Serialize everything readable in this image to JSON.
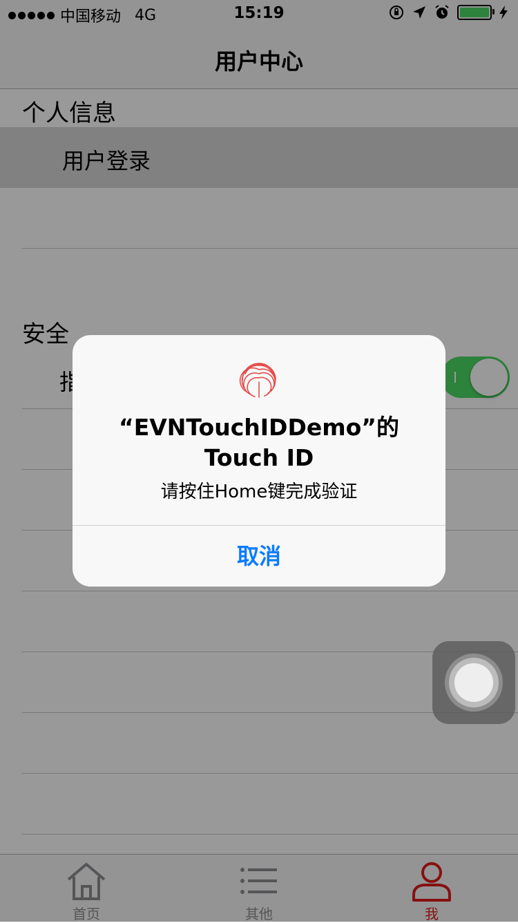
{
  "status_bar": {
    "carrier": "中国移动",
    "network": "4G",
    "time": "15:19",
    "icons": [
      "orientation-lock-icon",
      "location-arrow-icon",
      "alarm-icon",
      "battery-icon",
      "charging-bolt-icon"
    ]
  },
  "nav": {
    "title": "用户中心"
  },
  "sections": {
    "personal": {
      "header": "个人信息",
      "rows": [
        {
          "label": "用户登录"
        }
      ]
    },
    "security": {
      "header": "安全",
      "rows": [
        {
          "label": "指"
        }
      ],
      "toggle_on": true
    }
  },
  "alert": {
    "icon": "fingerprint-icon",
    "title": "“EVNTouchIDDemo”的 Touch ID",
    "message": "请按住Home键完成验证",
    "cancel_label": "取消"
  },
  "tabs": [
    {
      "label": "首页",
      "icon": "home-icon",
      "active": false
    },
    {
      "label": "其他",
      "icon": "list-icon",
      "active": false
    },
    {
      "label": "我",
      "icon": "user-icon",
      "active": true
    }
  ],
  "colors": {
    "accent_red": "#e01b1b",
    "toggle_green": "#4cd964",
    "link_blue": "#0a7bff"
  }
}
